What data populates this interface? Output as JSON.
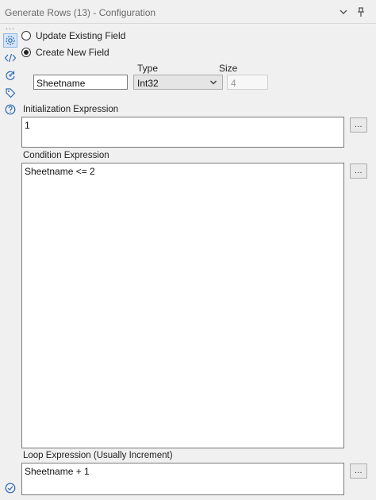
{
  "window": {
    "title": "Generate Rows (13) - Configuration",
    "overflow_dots": "...",
    "more_dots": "..."
  },
  "icons": {
    "collapse": "chevron-down-icon",
    "pin": "pin-icon",
    "sidebar": [
      "gear-icon",
      "code-icon",
      "refresh-icon",
      "tag-icon",
      "help-icon"
    ],
    "status": "check-circle-icon"
  },
  "options": {
    "update_existing_label": "Update Existing Field",
    "create_new_label": "Create New  Field",
    "selected": "create_new"
  },
  "field": {
    "name": "Sheetname",
    "type_label": "Type",
    "type_value": "Int32",
    "size_label": "Size",
    "size_value": "4"
  },
  "expressions": {
    "init_label": "Initialization Expression",
    "init_value": "1",
    "condition_label": "Condition Expression",
    "condition_value": "Sheetname <= 2",
    "loop_label": "Loop Expression (Usually Increment)",
    "loop_value": "Sheetname + 1",
    "button_label": "..."
  },
  "colors": {
    "accent_active": "#d6e6f8",
    "panel_bg": "#f0f0f0"
  }
}
